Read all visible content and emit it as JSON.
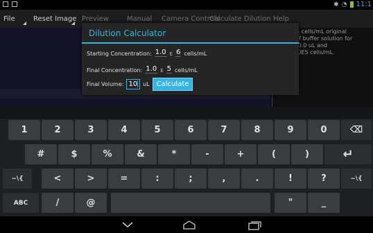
{
  "actionbar": {
    "items": [
      "File",
      "Reset Image",
      "Preview",
      "Manual",
      "Camera Controls",
      "Calculate Dilution",
      "Help"
    ]
  },
  "info_panel": {
    "lines": [
      "of 1.0E6 cells/mL original",
      "1.0 uL of buffer solution for",
      "me of 10.0 uL and",
      "on of 1.0E5 cells/mL."
    ]
  },
  "dialog": {
    "title": "Dilution Calculator",
    "start_label": "Starting Concentration:",
    "start_value": "1.0",
    "start_exp": "6",
    "final_label": "Final Concentration:",
    "final_value": "1.0",
    "final_exp": "5",
    "e_label": "E",
    "unit": "cells/mL",
    "volume_label": "Final Volume:",
    "volume_value": "10",
    "volume_unit": "uL",
    "calculate_label": "Calculate"
  },
  "keyboard": {
    "row1": [
      "1",
      "2",
      "3",
      "4",
      "5",
      "6",
      "7",
      "8",
      "9",
      "0",
      "⌫"
    ],
    "row2": [
      "#",
      "$",
      "%",
      "&",
      "*",
      "-",
      "+",
      "(",
      ")",
      "↵"
    ],
    "row3": [
      "~\\{",
      "<",
      ">",
      "=",
      ":",
      ";",
      ",",
      ".",
      "!",
      "?",
      "~\\{"
    ],
    "row4_abc": "ABC",
    "row4_slash": "/",
    "row4_at": "@",
    "row4_quote": "\"",
    "row4_underscore": "_"
  },
  "status": {
    "time": "11:1"
  }
}
